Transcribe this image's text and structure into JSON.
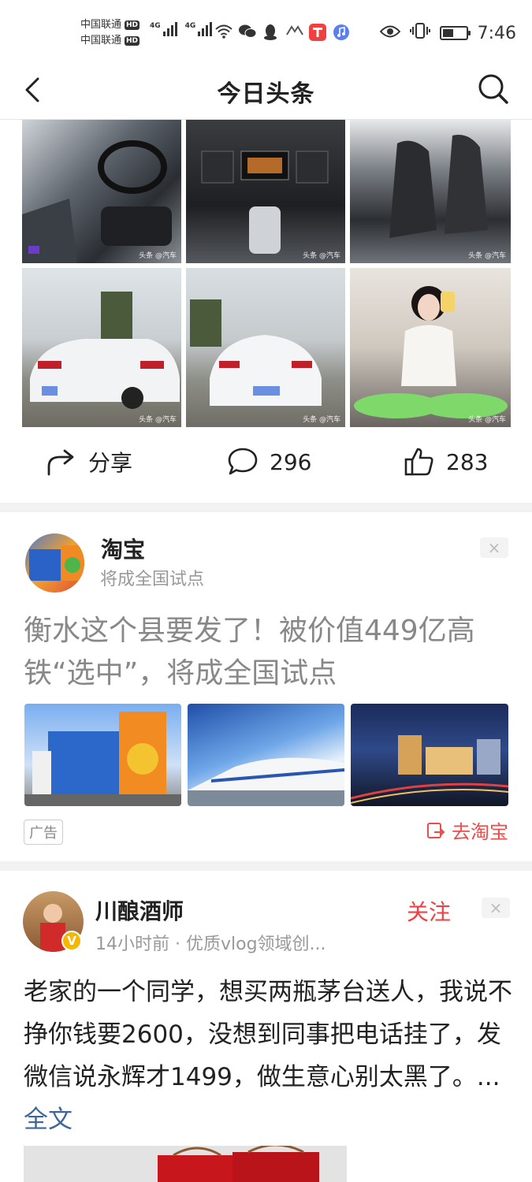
{
  "status_bar": {
    "carrier1": "中国联通",
    "carrier2": "中国联通",
    "hd": "HD",
    "net1": "4G",
    "net2": "4G",
    "time": "7:46",
    "battery_level": 0.45
  },
  "header": {
    "title": "今日头条"
  },
  "post1": {
    "watermark": "头条 @汽车",
    "actions": {
      "share_label": "分享",
      "comment_count": "296",
      "like_count": "283"
    }
  },
  "ad": {
    "account_name": "淘宝",
    "account_sub": "将成全国试点",
    "headline": "衡水这个县要发了！被价值449亿高铁“选中”，将成全国试点",
    "ad_tag": "广告",
    "goto_label": "去淘宝",
    "close": "×"
  },
  "post2": {
    "author": "川酿酒师",
    "meta": "14小时前 · 优质vlog领域创...",
    "follow_label": "关注",
    "close": "×",
    "verified": "V",
    "text": "老家的一个同学，想买两瓶茅台送人，我说不挣你钱要2600，没想到同事把电话挂了，发微信说永辉才1499，做生意心别太黑了。",
    "ellipsis": "...",
    "more_label": "全文"
  },
  "colors": {
    "accent_red": "#f04142",
    "link_blue": "#406599",
    "ad_red": "#e94e4e"
  }
}
